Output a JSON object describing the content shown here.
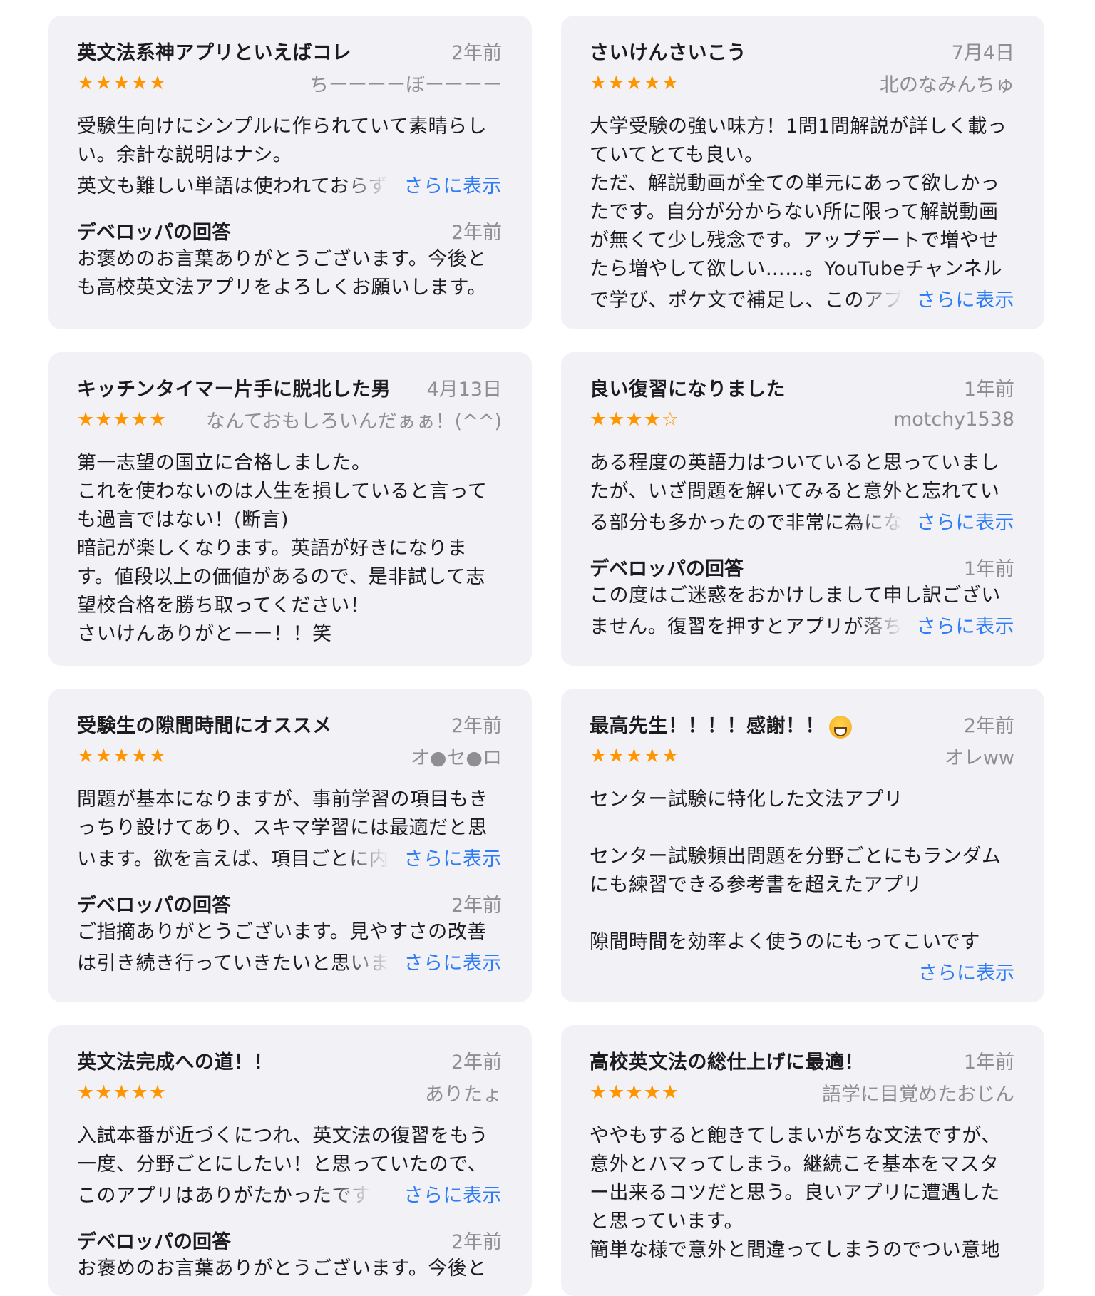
{
  "more_label": "さらに表示",
  "dev_response_label": "デベロッパの回答",
  "accent_color": "#2f7cf6",
  "star_color": "#ff9500",
  "reviews": [
    {
      "title": "英文法系神アプリといえばコレ",
      "date": "2年前",
      "stars": "★★★★★",
      "rating": 5,
      "author": "ちーーーーぼーーーー",
      "body": "受験生向けにシンプルに作られていて素晴らし\nい。余計な説明はナシ。",
      "body_tail": "英文も難しい単語は使われておらず",
      "dev_date": "2年前",
      "dev_text": "お褒めのお言葉ありがとうございます。今後と\nも高校英文法アプリをよろしくお願いします。"
    },
    {
      "title": "さいけんさいこう",
      "date": "7月4日",
      "stars": "★★★★★",
      "rating": 5,
      "author": "北のなみんちゅ",
      "body": "大学受験の強い味方！1問1問解説が詳しく載っ\nていてとても良い。\nただ、解説動画が全ての単元にあって欲しかっ\nたです。自分が分からない所に限って解説動画\nが無くて少し残念です。アップデートで増やせ\nたら増やして欲しい……。YouTubeチャンネル",
      "body_tail": "で学び、ポケ文で補足し、このアプ"
    },
    {
      "title": "キッチンタイマー片手に脱北した男",
      "date": "4月13日",
      "stars": "★★★★★",
      "rating": 5,
      "author": "なんておもしろいんだぁぁ！(^^)",
      "body": "第一志望の国立に合格しました。\nこれを使わないのは人生を損していると言って\nも過言ではない！(断言)\n暗記が楽しくなります。英語が好きになりま\nす。値段以上の価値があるので、是非試して志\n望校合格を勝ち取ってください！\nさいけんありがとーー！！笑"
    },
    {
      "title": "良い復習になりました",
      "date": "1年前",
      "stars": "★★★★☆",
      "rating": 4,
      "author": "motchy1538",
      "body": "ある程度の英語力はついていると思っていまし\nたが、いざ問題を解いてみると意外と忘れてい",
      "body_tail": "る部分も多かったので非常に為にな",
      "dev_date": "1年前",
      "dev_text": "この度はご迷惑をおかけしまして申し訳ござい",
      "dev_tail": "ません。復習を押すとアプリが落ち"
    },
    {
      "title": "受験生の隙間時間にオススメ",
      "date": "2年前",
      "stars": "★★★★★",
      "rating": 5,
      "author": "オ●セ●ロ",
      "body": "問題が基本になりますが、事前学習の項目もき\nっちり設けてあり、スキマ学習には最適だと思",
      "body_tail": "います。欲を言えば、項目ごとに内",
      "dev_date": "2年前",
      "dev_text": "ご指摘ありがとうございます。見やすさの改善",
      "dev_tail": "は引き続き行っていきたいと思いま"
    },
    {
      "title": "最高先生！！！！感謝！！",
      "date": "2年前",
      "stars": "★★★★★",
      "rating": 5,
      "author": "オレww",
      "body": "センター試験に特化した文法アプリ\n\nセンター試験頻出問題を分野ごとにもランダム\nにも練習できる参考書を超えたアプリ\n\n隙間時間を効率よく使うのにもってこいです"
    },
    {
      "title": "英文法完成への道！！",
      "date": "2年前",
      "stars": "★★★★★",
      "rating": 5,
      "author": "ありたょ",
      "body": "入試本番が近づくにつれ、英文法の復習をもう\n一度、分野ごとにしたい！と思っていたので、",
      "body_tail": "このアプリはありがたかったです",
      "dev_date": "2年前",
      "dev_text": "お褒めのお言葉ありがとうございます。今後と"
    },
    {
      "title": "高校英文法の総仕上げに最適！",
      "date": "1年前",
      "stars": "★★★★★",
      "rating": 5,
      "author": "語学に目覚めたおじん",
      "body": "ややもすると飽きてしまいがちな文法ですが、\n意外とハマってしまう。継続こそ基本をマスタ\nー出来るコツだと思う。良いアプリに遭遇した\nと思っています。\n簡単な様で意外と間違ってしまうのでつい意地"
    }
  ]
}
